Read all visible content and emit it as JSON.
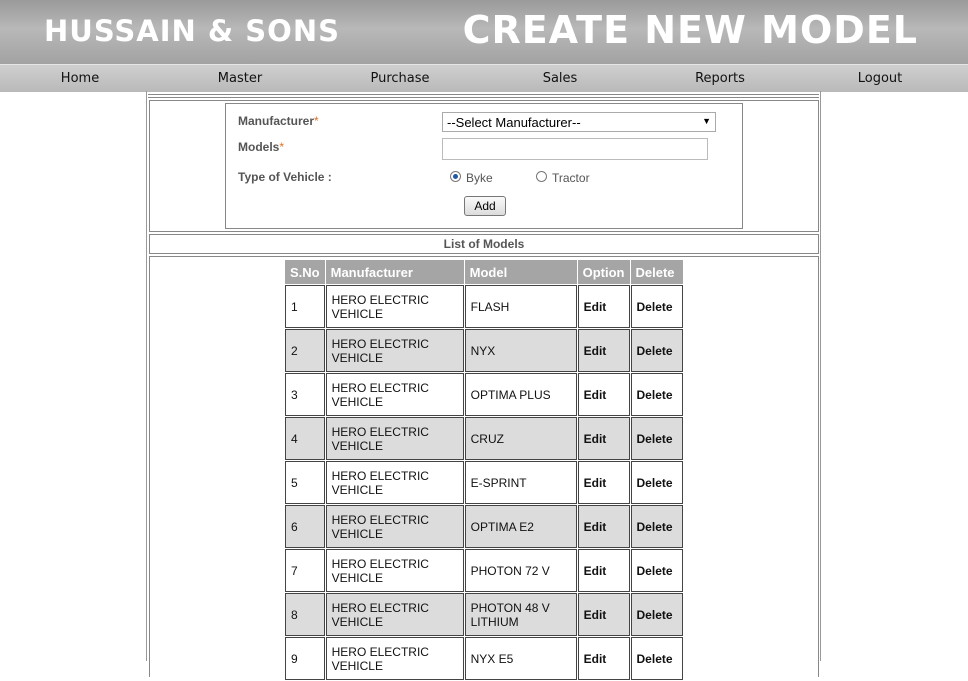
{
  "header": {
    "brand": "HUSSAIN & SONS",
    "page_title": "CREATE NEW MODEL"
  },
  "nav": [
    "Home",
    "Master",
    "Purchase",
    "Sales",
    "Reports",
    "Logout"
  ],
  "form": {
    "manufacturer_label": "Manufacturer",
    "models_label": "Models",
    "required_mark": "*",
    "vehicle_type_label": "Type of Vehicle :",
    "manufacturer_selected": "--Select Manufacturer--",
    "models_value": "",
    "vehicle_types": [
      "Byke",
      "Tractor"
    ],
    "vehicle_selected": "Byke",
    "add_label": "Add"
  },
  "list": {
    "title": "List of Models",
    "columns": [
      "S.No",
      "Manufacturer",
      "Model",
      "Option",
      "Delete"
    ],
    "rows": [
      {
        "sno": "1",
        "manufacturer": "HERO ELECTRIC VEHICLE",
        "model": "FLASH",
        "option": "Edit",
        "delete": "Delete"
      },
      {
        "sno": "2",
        "manufacturer": "HERO ELECTRIC VEHICLE",
        "model": "NYX",
        "option": "Edit",
        "delete": "Delete"
      },
      {
        "sno": "3",
        "manufacturer": "HERO ELECTRIC VEHICLE",
        "model": "OPTIMA PLUS",
        "option": "Edit",
        "delete": "Delete"
      },
      {
        "sno": "4",
        "manufacturer": "HERO ELECTRIC VEHICLE",
        "model": "CRUZ",
        "option": "Edit",
        "delete": "Delete"
      },
      {
        "sno": "5",
        "manufacturer": "HERO ELECTRIC VEHICLE",
        "model": "E-SPRINT",
        "option": "Edit",
        "delete": "Delete"
      },
      {
        "sno": "6",
        "manufacturer": "HERO ELECTRIC VEHICLE",
        "model": "OPTIMA E2",
        "option": "Edit",
        "delete": "Delete"
      },
      {
        "sno": "7",
        "manufacturer": "HERO ELECTRIC VEHICLE",
        "model": "PHOTON 72 V",
        "option": "Edit",
        "delete": "Delete"
      },
      {
        "sno": "8",
        "manufacturer": "HERO ELECTRIC VEHICLE",
        "model": "PHOTON 48 V LITHIUM",
        "option": "Edit",
        "delete": "Delete"
      },
      {
        "sno": "9",
        "manufacturer": "HERO ELECTRIC VEHICLE",
        "model": "NYX E5",
        "option": "Edit",
        "delete": "Delete"
      }
    ]
  }
}
